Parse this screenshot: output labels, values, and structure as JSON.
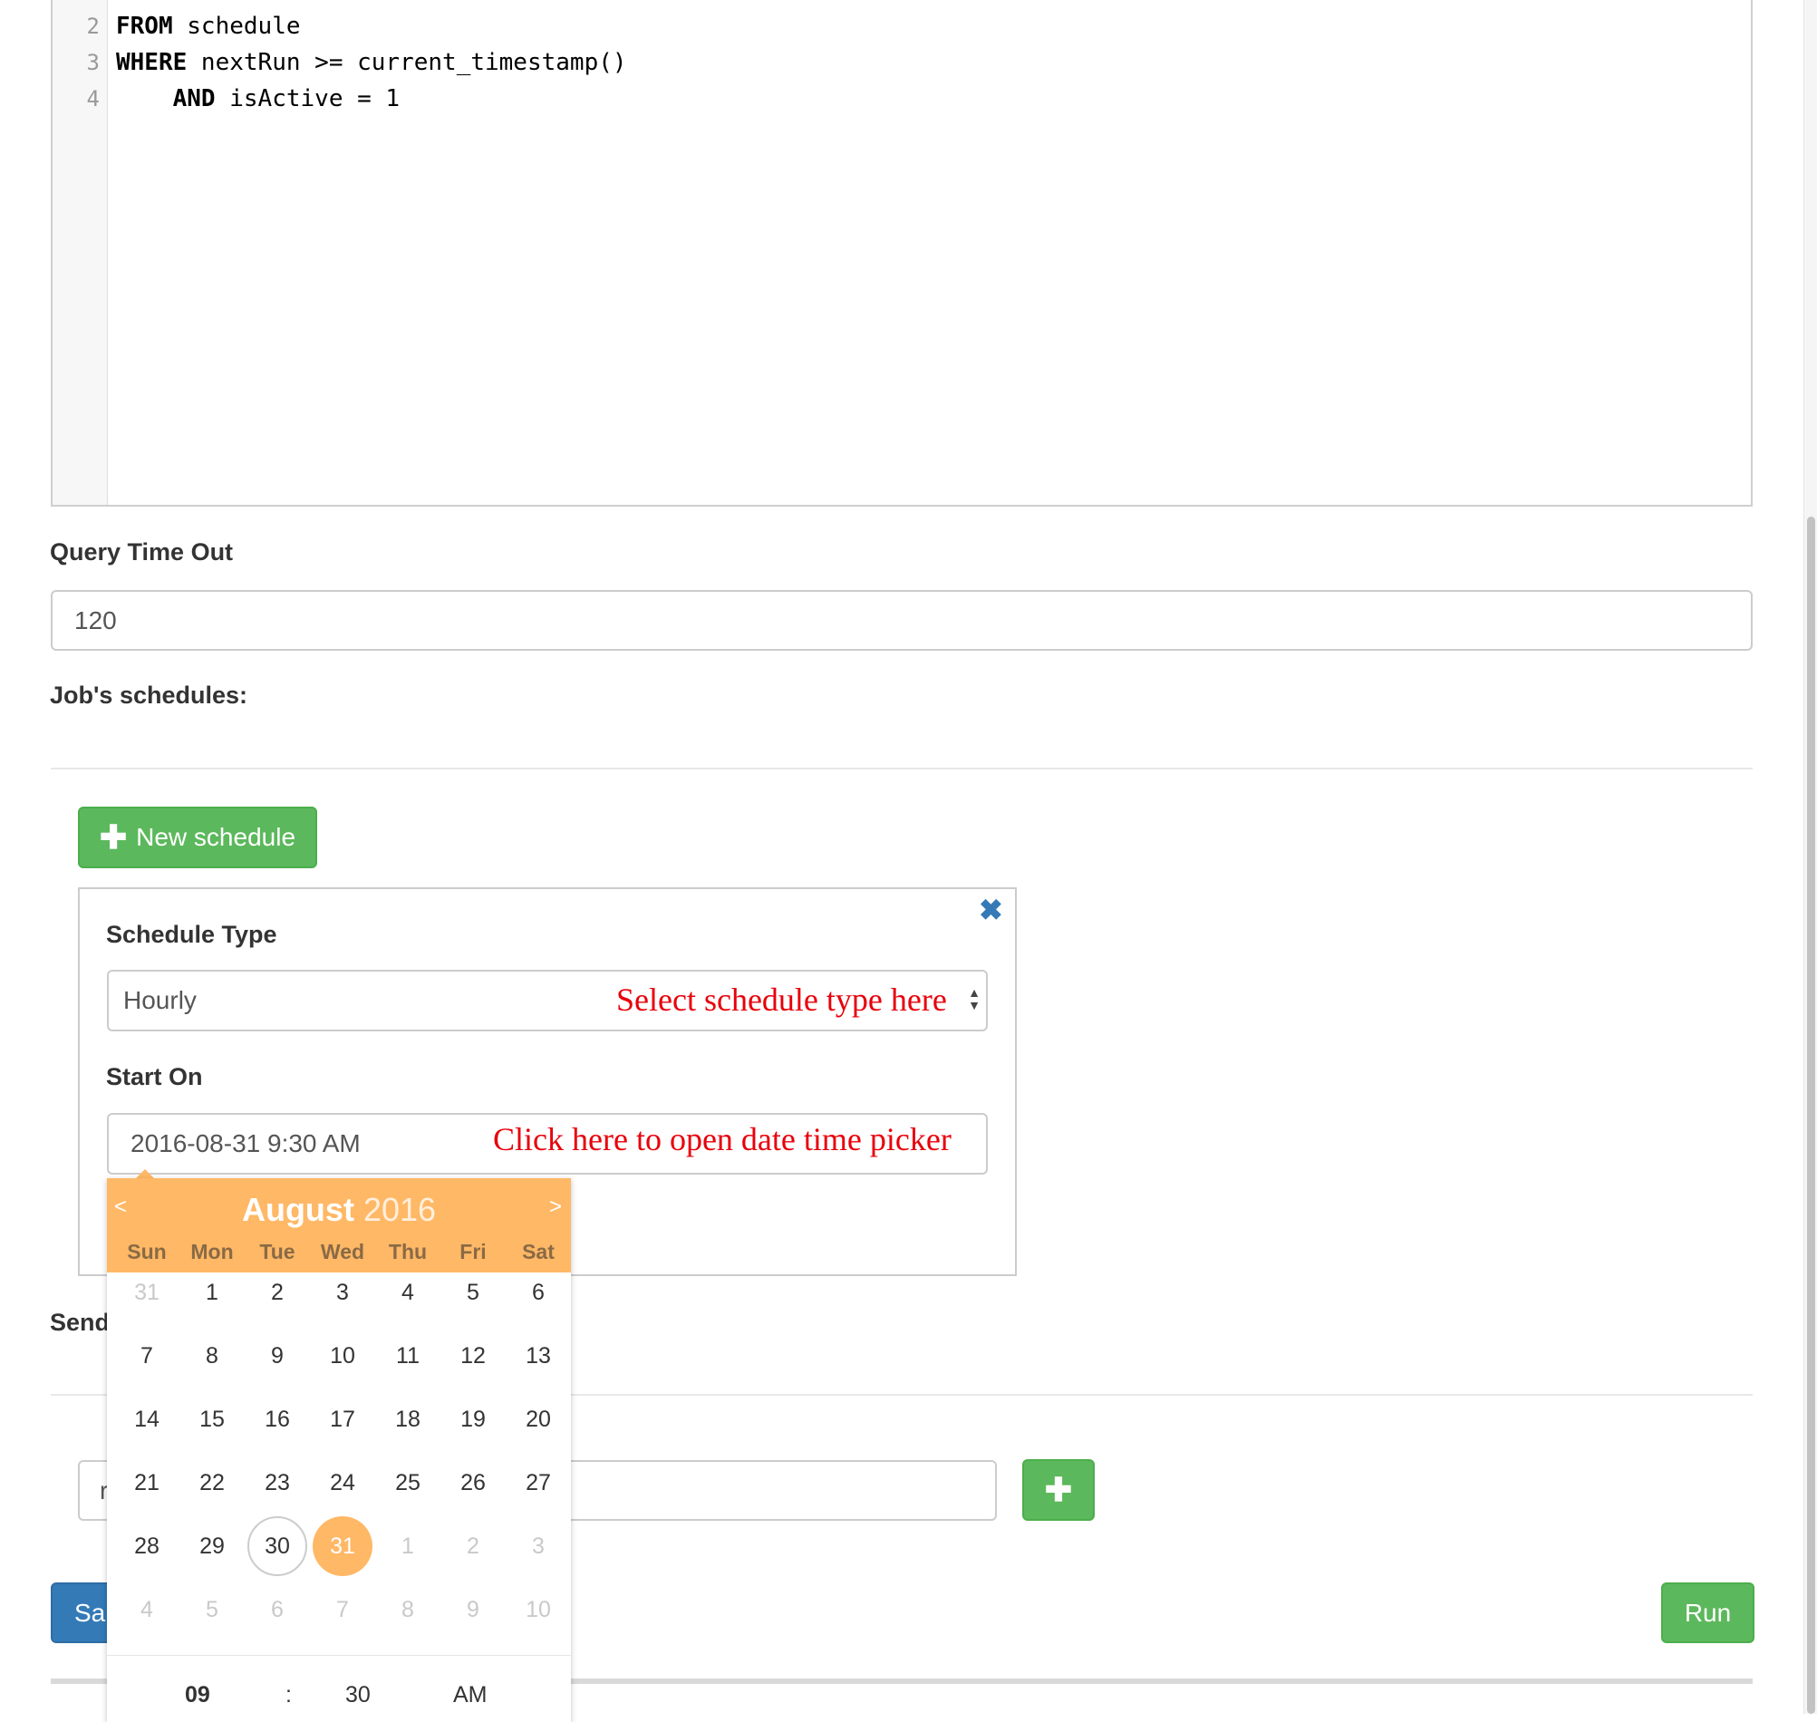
{
  "editor": {
    "lines": [
      {
        "num": "2",
        "kw": "FROM",
        "rest": " schedule",
        "indent": ""
      },
      {
        "num": "3",
        "kw": "WHERE",
        "rest": " nextRun >= current_timestamp()",
        "indent": ""
      },
      {
        "num": "4",
        "kw": "AND",
        "rest": " isActive = 1",
        "indent": "    "
      }
    ]
  },
  "query_timeout": {
    "label": "Query Time Out",
    "value": "120"
  },
  "schedules": {
    "label": "Job's schedules:",
    "new_button": "New schedule",
    "new_button_icon": "plus-icon",
    "close_icon": "close-icon"
  },
  "schedule_form": {
    "type_label": "Schedule Type",
    "type_value": "Hourly",
    "type_annotation": "Select schedule type here",
    "start_label": "Start On",
    "start_value": "2016-08-31 9:30 AM",
    "start_annotation": "Click here to open date time picker"
  },
  "send_label": "Send",
  "email_input_value": "r",
  "add_icon": "plus-icon",
  "save_button": "Sa",
  "run_button": "Run",
  "datepicker": {
    "month": "August",
    "year": "2016",
    "prev": "<",
    "next": ">",
    "dow": [
      "Sun",
      "Mon",
      "Tue",
      "Wed",
      "Thu",
      "Fri",
      "Sat"
    ],
    "weeks": [
      [
        "31",
        "1",
        "2",
        "3",
        "4",
        "5",
        "6"
      ],
      [
        "7",
        "8",
        "9",
        "10",
        "11",
        "12",
        "13"
      ],
      [
        "14",
        "15",
        "16",
        "17",
        "18",
        "19",
        "20"
      ],
      [
        "21",
        "22",
        "23",
        "24",
        "25",
        "26",
        "27"
      ],
      [
        "28",
        "29",
        "30",
        "31",
        "1",
        "2",
        "3"
      ],
      [
        "4",
        "5",
        "6",
        "7",
        "8",
        "9",
        "10"
      ]
    ],
    "today": "30",
    "selected": "31",
    "time": {
      "hour": "09",
      "sep": ":",
      "minute": "30",
      "ampm": "AM"
    },
    "colors": {
      "accent": "#ffb866",
      "selected_text": "#ffffff"
    }
  },
  "colors": {
    "green": "#5cb85c",
    "blue": "#337ab7",
    "annotation_red": "#e8000b"
  }
}
